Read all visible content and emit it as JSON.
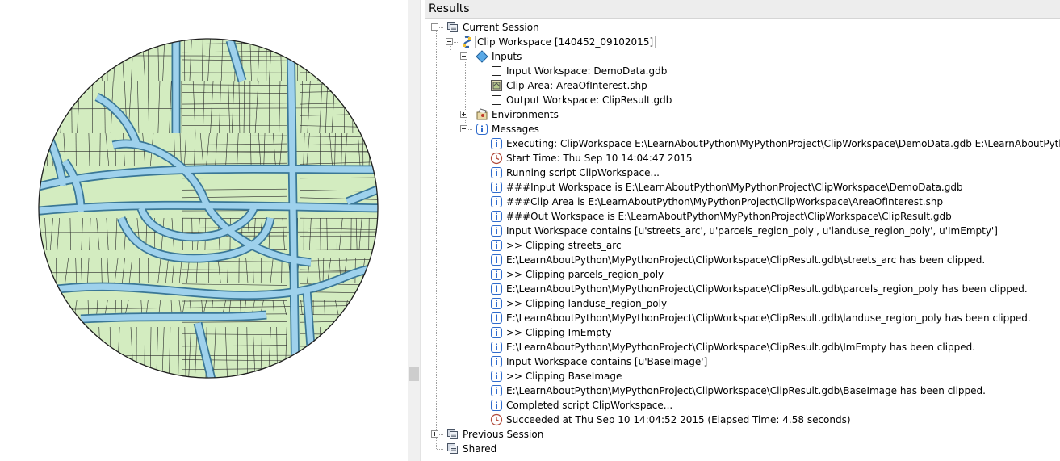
{
  "colors": {
    "parcel_fill": "#d3ecc0",
    "parcel_line": "#2b2b2b",
    "street_fill": "#9ed1ec",
    "street_edge": "#3a7796",
    "info_icon": "#2f6bcc",
    "header_bg": "#ededed"
  },
  "results": {
    "title": "Results",
    "current_session": {
      "label": "Current Session",
      "icon": "sessions-icon"
    },
    "tool": {
      "label": "Clip Workspace [140452_09102015]",
      "icon": "python-script-icon"
    },
    "inputs": {
      "label": "Inputs",
      "icon": "diamond-icon",
      "items": [
        {
          "label": "Input Workspace: DemoData.gdb",
          "icon": "empty-box-icon"
        },
        {
          "label": "Clip Area: AreaOfInterest.shp",
          "icon": "feature-class-icon"
        },
        {
          "label": "Output Workspace: ClipResult.gdb",
          "icon": "empty-box-icon"
        }
      ]
    },
    "environments": {
      "label": "Environments",
      "icon": "environments-icon"
    },
    "messages": {
      "label": "Messages",
      "icon": "info-icon",
      "items": [
        {
          "label": "Executing: ClipWorkspace E:\\LearnAboutPython\\MyPythonProject\\ClipWorkspace\\DemoData.gdb E:\\LearnAboutPython\\MyPytho",
          "icon": "info-icon"
        },
        {
          "label": "Start Time: Thu Sep 10 14:04:47 2015",
          "icon": "clock-icon"
        },
        {
          "label": "Running script ClipWorkspace...",
          "icon": "info-icon"
        },
        {
          "label": "###Input Workspace is E:\\LearnAboutPython\\MyPythonProject\\ClipWorkspace\\DemoData.gdb",
          "icon": "info-icon"
        },
        {
          "label": "###Clip Area is E:\\LearnAboutPython\\MyPythonProject\\ClipWorkspace\\AreaOfInterest.shp",
          "icon": "info-icon"
        },
        {
          "label": "###Out Workspace is E:\\LearnAboutPython\\MyPythonProject\\ClipWorkspace\\ClipResult.gdb",
          "icon": "info-icon"
        },
        {
          "label": "Input Workspace contains [u'streets_arc', u'parcels_region_poly', u'landuse_region_poly', u'ImEmpty']",
          "icon": "info-icon"
        },
        {
          "label": ">> Clipping  streets_arc",
          "icon": "info-icon"
        },
        {
          "label": "E:\\LearnAboutPython\\MyPythonProject\\ClipWorkspace\\ClipResult.gdb\\streets_arc has been clipped.",
          "icon": "info-icon"
        },
        {
          "label": ">> Clipping  parcels_region_poly",
          "icon": "info-icon"
        },
        {
          "label": "E:\\LearnAboutPython\\MyPythonProject\\ClipWorkspace\\ClipResult.gdb\\parcels_region_poly has been clipped.",
          "icon": "info-icon"
        },
        {
          "label": ">> Clipping  landuse_region_poly",
          "icon": "info-icon"
        },
        {
          "label": "E:\\LearnAboutPython\\MyPythonProject\\ClipWorkspace\\ClipResult.gdb\\landuse_region_poly has been clipped.",
          "icon": "info-icon"
        },
        {
          "label": ">> Clipping  ImEmpty",
          "icon": "info-icon"
        },
        {
          "label": "E:\\LearnAboutPython\\MyPythonProject\\ClipWorkspace\\ClipResult.gdb\\ImEmpty has been clipped.",
          "icon": "info-icon"
        },
        {
          "label": "Input Workspace contains [u'BaseImage']",
          "icon": "info-icon"
        },
        {
          "label": ">> Clipping  BaseImage",
          "icon": "info-icon"
        },
        {
          "label": "E:\\LearnAboutPython\\MyPythonProject\\ClipWorkspace\\ClipResult.gdb\\BaseImage has been clipped.",
          "icon": "info-icon"
        },
        {
          "label": "Completed script ClipWorkspace...",
          "icon": "info-icon"
        },
        {
          "label": "Succeeded at Thu Sep 10 14:04:52 2015 (Elapsed Time: 4.58 seconds)",
          "icon": "clock-icon"
        }
      ]
    },
    "previous_session": {
      "label": "Previous Session",
      "icon": "sessions-icon"
    },
    "shared": {
      "label": "Shared",
      "icon": "sessions-icon"
    }
  }
}
